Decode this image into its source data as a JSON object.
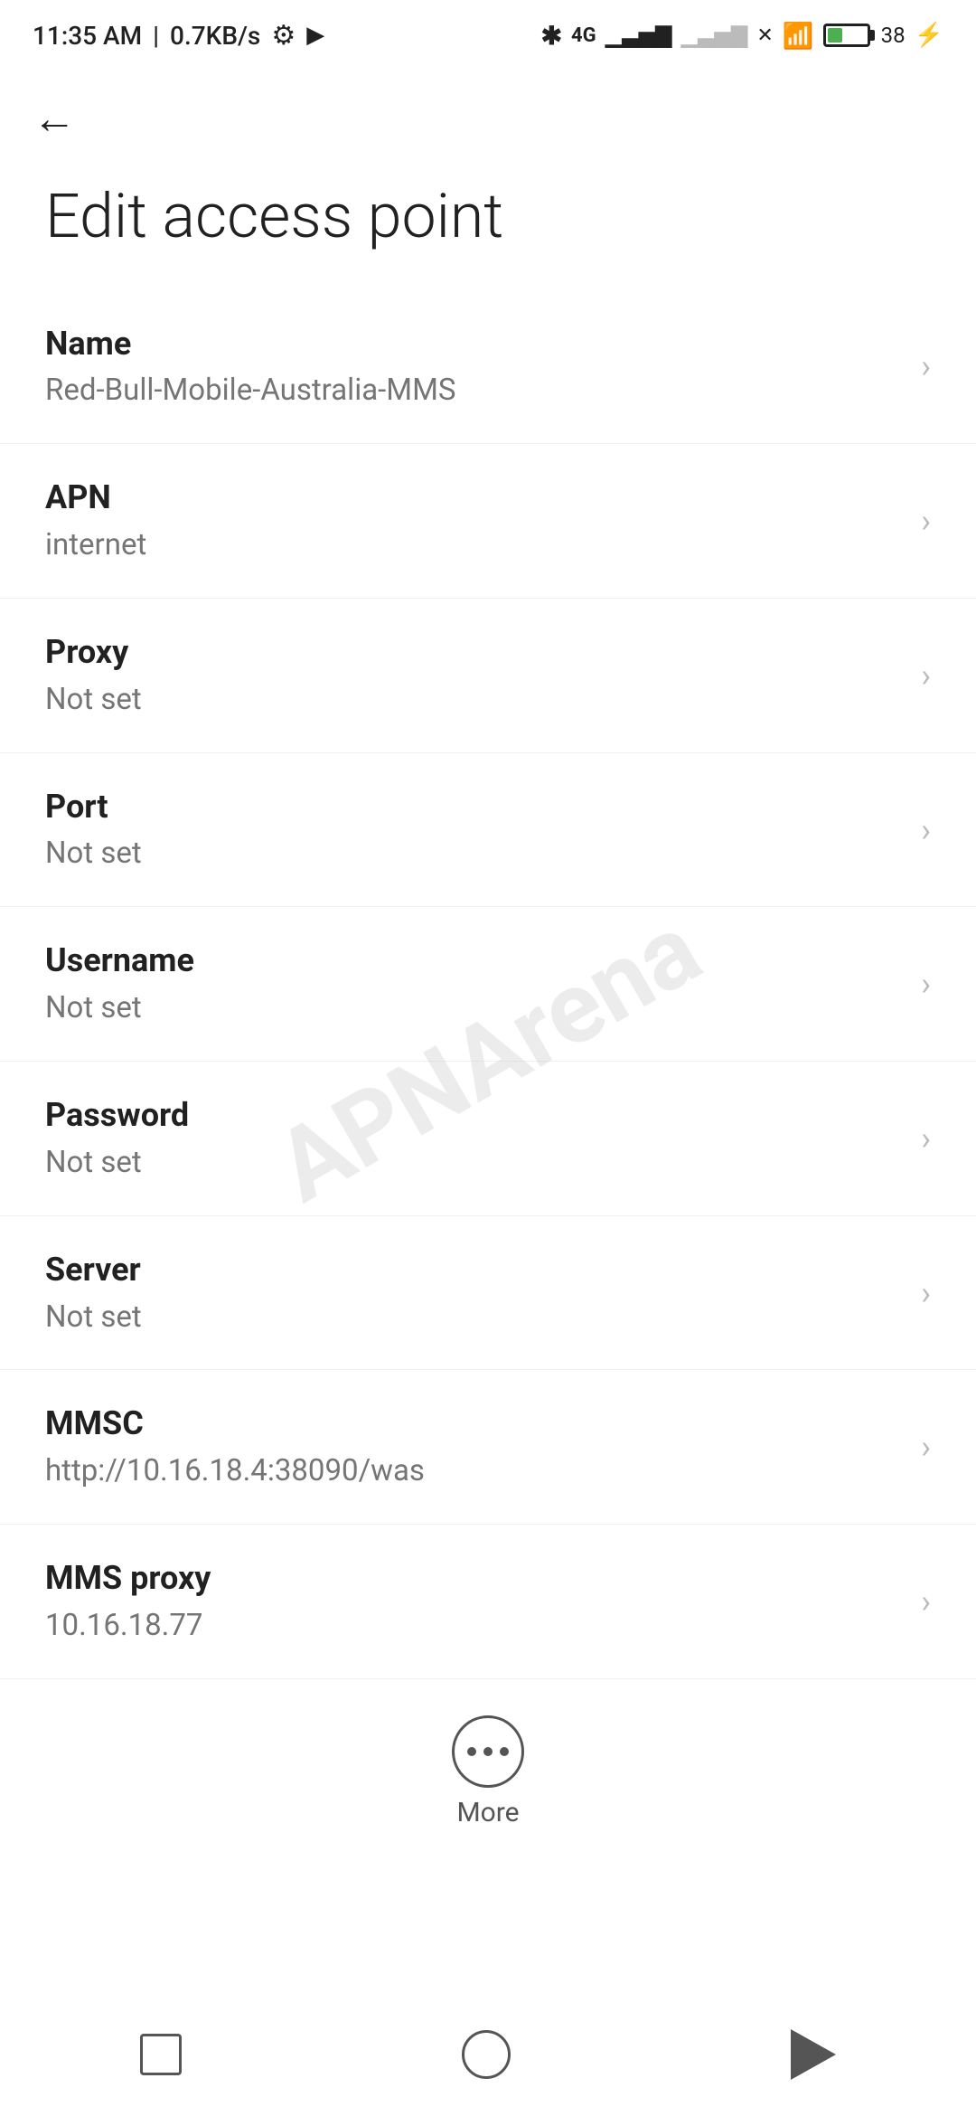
{
  "statusBar": {
    "time": "11:35 AM",
    "speed": "0.7KB/s"
  },
  "page": {
    "title": "Edit access point",
    "backLabel": "←"
  },
  "fields": [
    {
      "label": "Name",
      "value": "Red-Bull-Mobile-Australia-MMS",
      "id": "name"
    },
    {
      "label": "APN",
      "value": "internet",
      "id": "apn"
    },
    {
      "label": "Proxy",
      "value": "Not set",
      "id": "proxy"
    },
    {
      "label": "Port",
      "value": "Not set",
      "id": "port"
    },
    {
      "label": "Username",
      "value": "Not set",
      "id": "username"
    },
    {
      "label": "Password",
      "value": "Not set",
      "id": "password"
    },
    {
      "label": "Server",
      "value": "Not set",
      "id": "server"
    },
    {
      "label": "MMSC",
      "value": "http://10.16.18.4:38090/was",
      "id": "mmsc"
    },
    {
      "label": "MMS proxy",
      "value": "10.16.18.77",
      "id": "mms-proxy"
    }
  ],
  "bottomButton": {
    "label": "More"
  },
  "watermark": "APNArena"
}
